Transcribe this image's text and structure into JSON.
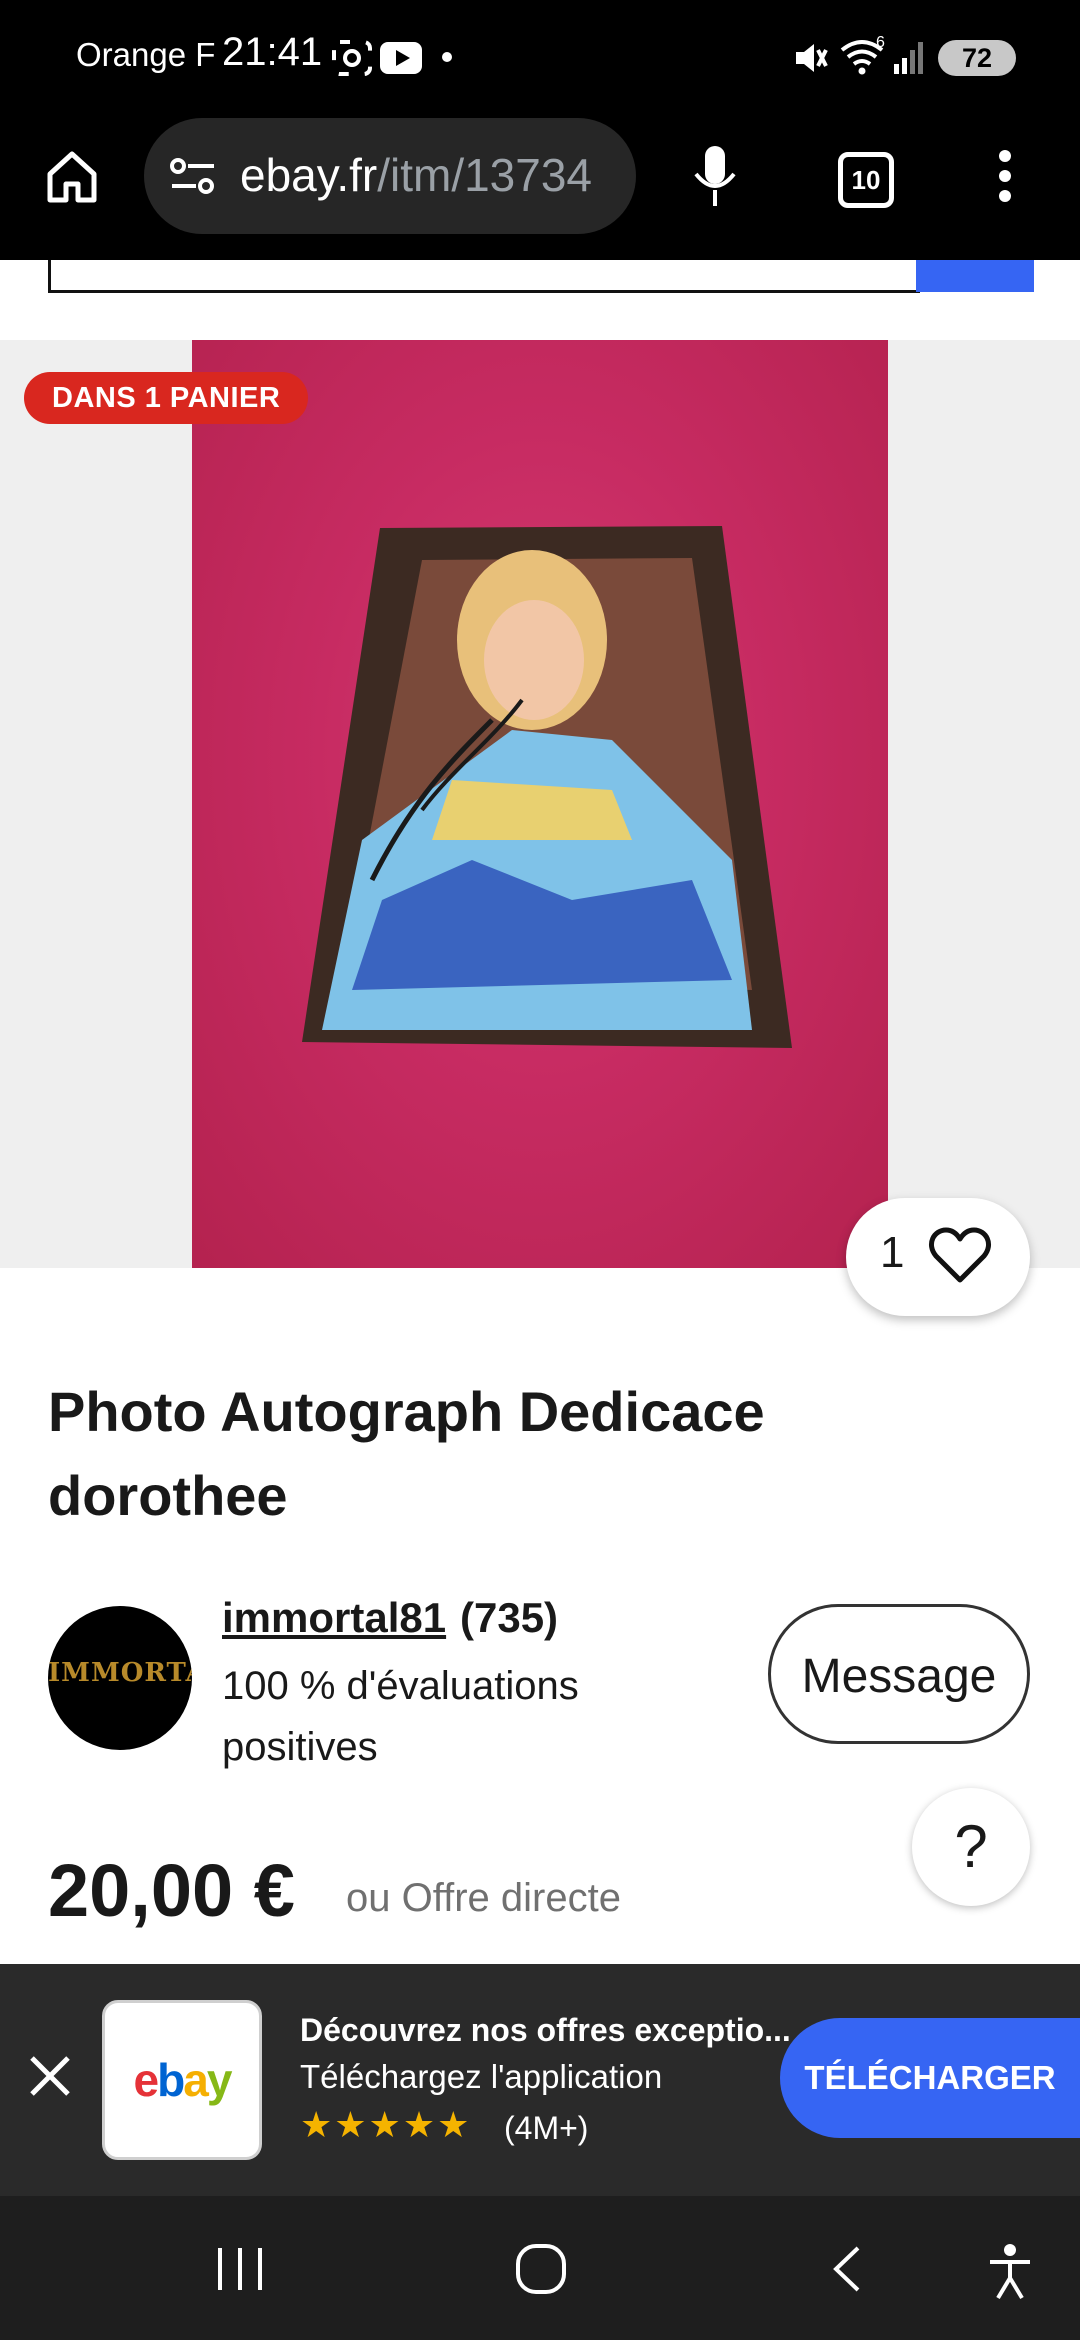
{
  "status_bar": {
    "carrier": "Orange F",
    "time": "21:41",
    "battery": "72",
    "signal_tag": "6"
  },
  "browser": {
    "url_host": "ebay.fr",
    "url_path": "/itm/13734",
    "tab_count": "10"
  },
  "listing": {
    "badge": "DANS 1 PANIER",
    "like_count": "1",
    "title_line1": "Photo Autograph Dedicace",
    "title_line2": "dorothee",
    "seller": {
      "name": "immortal81",
      "feedback_count": "(735)",
      "rating_line1": "100 % d'évaluations",
      "rating_line2": "positives",
      "avatar_text": "IMMORTAL"
    },
    "message_label": "Message",
    "help_label": "?",
    "price": "20,00 €",
    "offer_text": "ou Offre directe"
  },
  "app_banner": {
    "logo_letters": [
      "e",
      "b",
      "a",
      "y"
    ],
    "title": "Découvrez nos offres exceptio...",
    "subtitle": "Téléchargez l'application",
    "stars": "★★★★★",
    "rating_count": "(4M+)",
    "cta": "TÉLÉCHARGER"
  },
  "colors": {
    "ebay_blue": "#3665f3",
    "badge_red": "#d9271f",
    "logo": [
      "#e53238",
      "#0064d2",
      "#f5af02",
      "#86b817"
    ]
  }
}
